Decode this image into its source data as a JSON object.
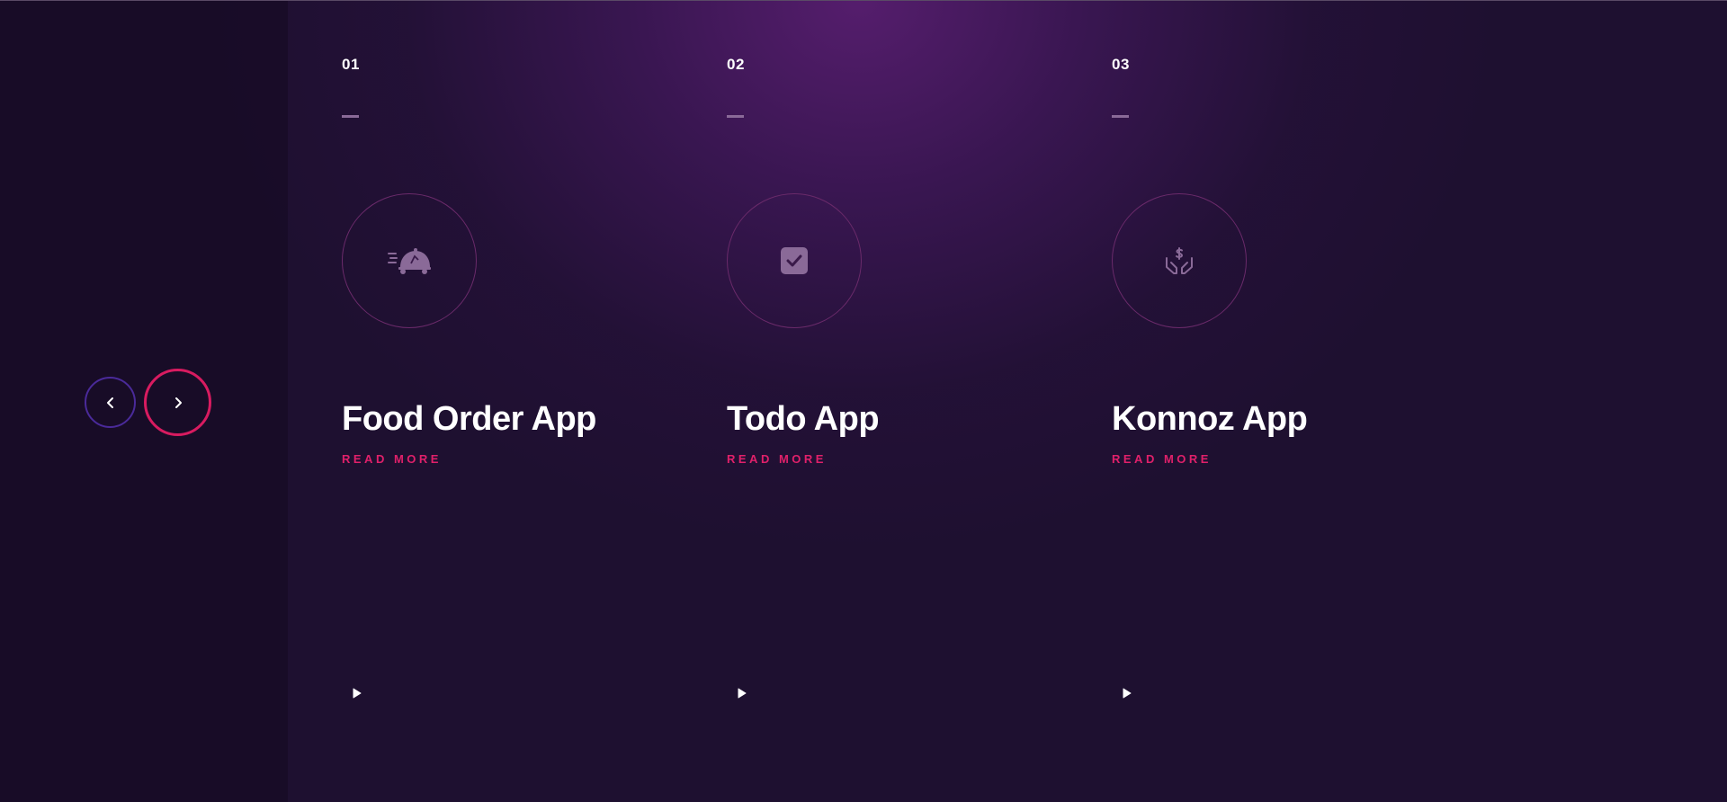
{
  "navigation": {
    "prev_icon": "chevron-left-icon",
    "next_icon": "chevron-right-icon"
  },
  "cards": [
    {
      "number": "01",
      "icon": "food-delivery-icon",
      "title": "Food Order App",
      "link_label": "READ MORE"
    },
    {
      "number": "02",
      "icon": "checkbox-icon",
      "title": "Todo App",
      "link_label": "READ MORE"
    },
    {
      "number": "03",
      "icon": "money-hands-icon",
      "title": "Konnoz App",
      "link_label": "READ MORE"
    }
  ],
  "colors": {
    "accent": "#e0206a",
    "prev_border": "#4a2a9a",
    "background": "#1e1030",
    "icon": "#8a6a98"
  }
}
